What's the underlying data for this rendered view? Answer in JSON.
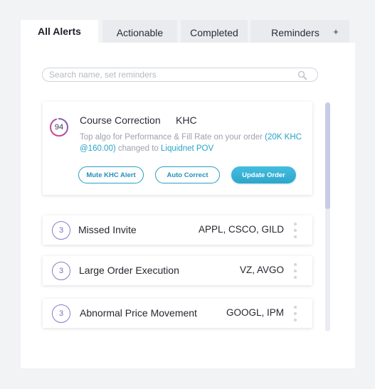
{
  "tabs": [
    {
      "label": "All Alerts",
      "active": true
    },
    {
      "label": "Actionable",
      "active": false
    },
    {
      "label": "Completed",
      "active": false
    },
    {
      "label": "Reminders",
      "active": false
    },
    {
      "label": "+",
      "active": false
    }
  ],
  "search": {
    "placeholder": "Search name, set reminders",
    "value": "",
    "icon": "search-icon"
  },
  "featured": {
    "score": "94",
    "score_fraction": 0.94,
    "title": "Course Correction",
    "ticker": "KHC",
    "desc_prefix": "Top algo for Performance & Fill Rate on your order ",
    "desc_order": "(20K KHC @160.00)",
    "desc_middle": " changed to ",
    "desc_algo": "Liquidnet POV",
    "buttons": {
      "mute": "Mute KHC Alert",
      "auto": "Auto Correct",
      "update": "Update Order"
    }
  },
  "alerts": [
    {
      "count": "3",
      "title": "Missed Invite",
      "tickers": "APPL, CSCO, GILD"
    },
    {
      "count": "3",
      "title": "Large Order Execution",
      "tickers": "VZ, AVGO"
    },
    {
      "count": "3",
      "title": "Abnormal Price Movement",
      "tickers": "GOOGL, IPM"
    }
  ],
  "colors": {
    "accent": "#2ea6cc",
    "count_ring": "#8a7cc4",
    "score_ring_start": "#e0467a",
    "score_ring_end": "#7a5cc8",
    "scroll_thumb": "#c7cbe6"
  }
}
